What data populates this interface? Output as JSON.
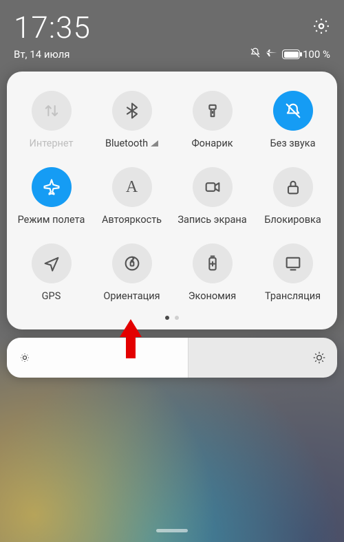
{
  "status": {
    "time": "17:35",
    "date": "Вт, 14 июля",
    "battery_pct": "100 %"
  },
  "tiles": {
    "internet": {
      "label": "Интернет"
    },
    "bluetooth": {
      "label": "Bluetooth"
    },
    "flashlight": {
      "label": "Фонарик"
    },
    "silent": {
      "label": "Без звука"
    },
    "airplane": {
      "label": "Режим полета"
    },
    "autobright": {
      "label": "Автояркость"
    },
    "screenrec": {
      "label": "Запись экрана"
    },
    "lock": {
      "label": "Блокировка"
    },
    "gps": {
      "label": "GPS"
    },
    "orientation": {
      "label": "Ориентация"
    },
    "battery_saver": {
      "label": "Экономия"
    },
    "cast": {
      "label": "Трансляция"
    }
  },
  "pager": {
    "current": 1,
    "total": 2
  },
  "brightness": {
    "value_pct": 55
  }
}
